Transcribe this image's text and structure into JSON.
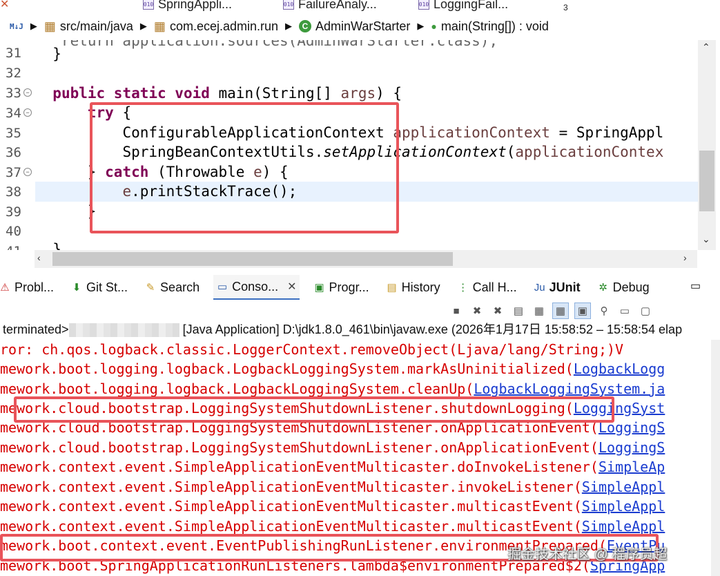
{
  "tabs": [
    {
      "label": "SpringAppli..."
    },
    {
      "label": "FailureAnaly..."
    },
    {
      "label": "LoggingFail..."
    }
  ],
  "tab_overflow": "3",
  "breadcrumb": {
    "folder": "src/main/java",
    "package": "com.ecej.admin.run",
    "class": "AdminWarStarter",
    "method": "main(String[]) : void"
  },
  "editor": {
    "line_numbers": [
      "31",
      "32",
      "33",
      "34",
      "35",
      "36",
      "37",
      "38",
      "39",
      "40",
      "41"
    ],
    "lines": {
      "l31": "}",
      "l33_kw": "public static void",
      "l33_rest": " main(String[] ",
      "l33_var": "args",
      "l33_end": ") {",
      "l34_kw": "try",
      "l34_end": " {",
      "l35_type": "ConfigurableApplicationContext ",
      "l35_var": "applicationContext",
      "l35_rest": " = SpringAppl",
      "l36_a": "SpringBeanContextUtils.",
      "l36_it": "setApplicationContext",
      "l36_b": "(",
      "l36_var": "applicationContex",
      "l37_a": "} ",
      "l37_kw": "catch",
      "l37_b": " (Throwable ",
      "l37_var": "e",
      "l37_c": ") {",
      "l38_var": "e",
      "l38_rest": ".printStackTrace();",
      "l39": "}",
      "l41": "}"
    }
  },
  "views": [
    {
      "label": "Probl...",
      "icon": "problems-icon"
    },
    {
      "label": "Git St...",
      "icon": "git-staging-icon"
    },
    {
      "label": "Search",
      "icon": "search-icon"
    },
    {
      "label": "Conso...",
      "icon": "console-icon"
    },
    {
      "label": "Progr...",
      "icon": "progress-icon"
    },
    {
      "label": "History",
      "icon": "history-icon"
    },
    {
      "label": "Call H...",
      "icon": "call-hierarchy-icon"
    },
    {
      "label": "JUnit",
      "icon": "junit-icon"
    },
    {
      "label": "Debug",
      "icon": "debug-icon"
    }
  ],
  "console": {
    "status_prefix": "terminated>",
    "status_text": "[Java Application] D:\\jdk1.8.0_461\\bin\\javaw.exe  (2026年1月17日 15:58:52 – 15:58:54 elap",
    "lines": [
      {
        "text": "ror: ch.qos.logback.classic.LoggerContext.removeObject(Ljava/lang/String;)V",
        "link": ""
      },
      {
        "text": "mework.boot.logging.logback.LogbackLoggingSystem.markAsUninitialized(",
        "link": "LogbackLogg"
      },
      {
        "text": "mework.boot.logging.logback.LogbackLoggingSystem.cleanUp(",
        "link": "LogbackLoggingSystem.ja"
      },
      {
        "text": "mework.cloud.bootstrap.LoggingSystemShutdownListener.shutdownLogging(",
        "link": "LoggingSyst"
      },
      {
        "text": "mework.cloud.bootstrap.LoggingSystemShutdownListener.onApplicationEvent(",
        "link": "LoggingS"
      },
      {
        "text": "mework.cloud.bootstrap.LoggingSystemShutdownListener.onApplicationEvent(",
        "link": "LoggingS"
      },
      {
        "text": "mework.context.event.SimpleApplicationEventMulticaster.doInvokeListener(",
        "link": "SimpleAp"
      },
      {
        "text": "mework.context.event.SimpleApplicationEventMulticaster.invokeListener(",
        "link": "SimpleAppl"
      },
      {
        "text": "mework.context.event.SimpleApplicationEventMulticaster.multicastEvent(",
        "link": "SimpleAppl"
      },
      {
        "text": "mework.context.event.SimpleApplicationEventMulticaster.multicastEvent(",
        "link": "SimpleAppl"
      },
      {
        "text": "mework.boot.context.event.EventPublishingRunListener.environmentPrepared(",
        "link": "EventPu"
      },
      {
        "text": "mework.boot.SpringApplicationRunListeners.lambda$environmentPrepared$2(",
        "link": "SpringApp"
      }
    ]
  },
  "watermark": "掘金技术社区 @ 程序员超",
  "colors": {
    "keyword": "#7f0055",
    "error": "#d60000",
    "link": "#1a3cd0",
    "highlight_box": "#e9545a"
  }
}
